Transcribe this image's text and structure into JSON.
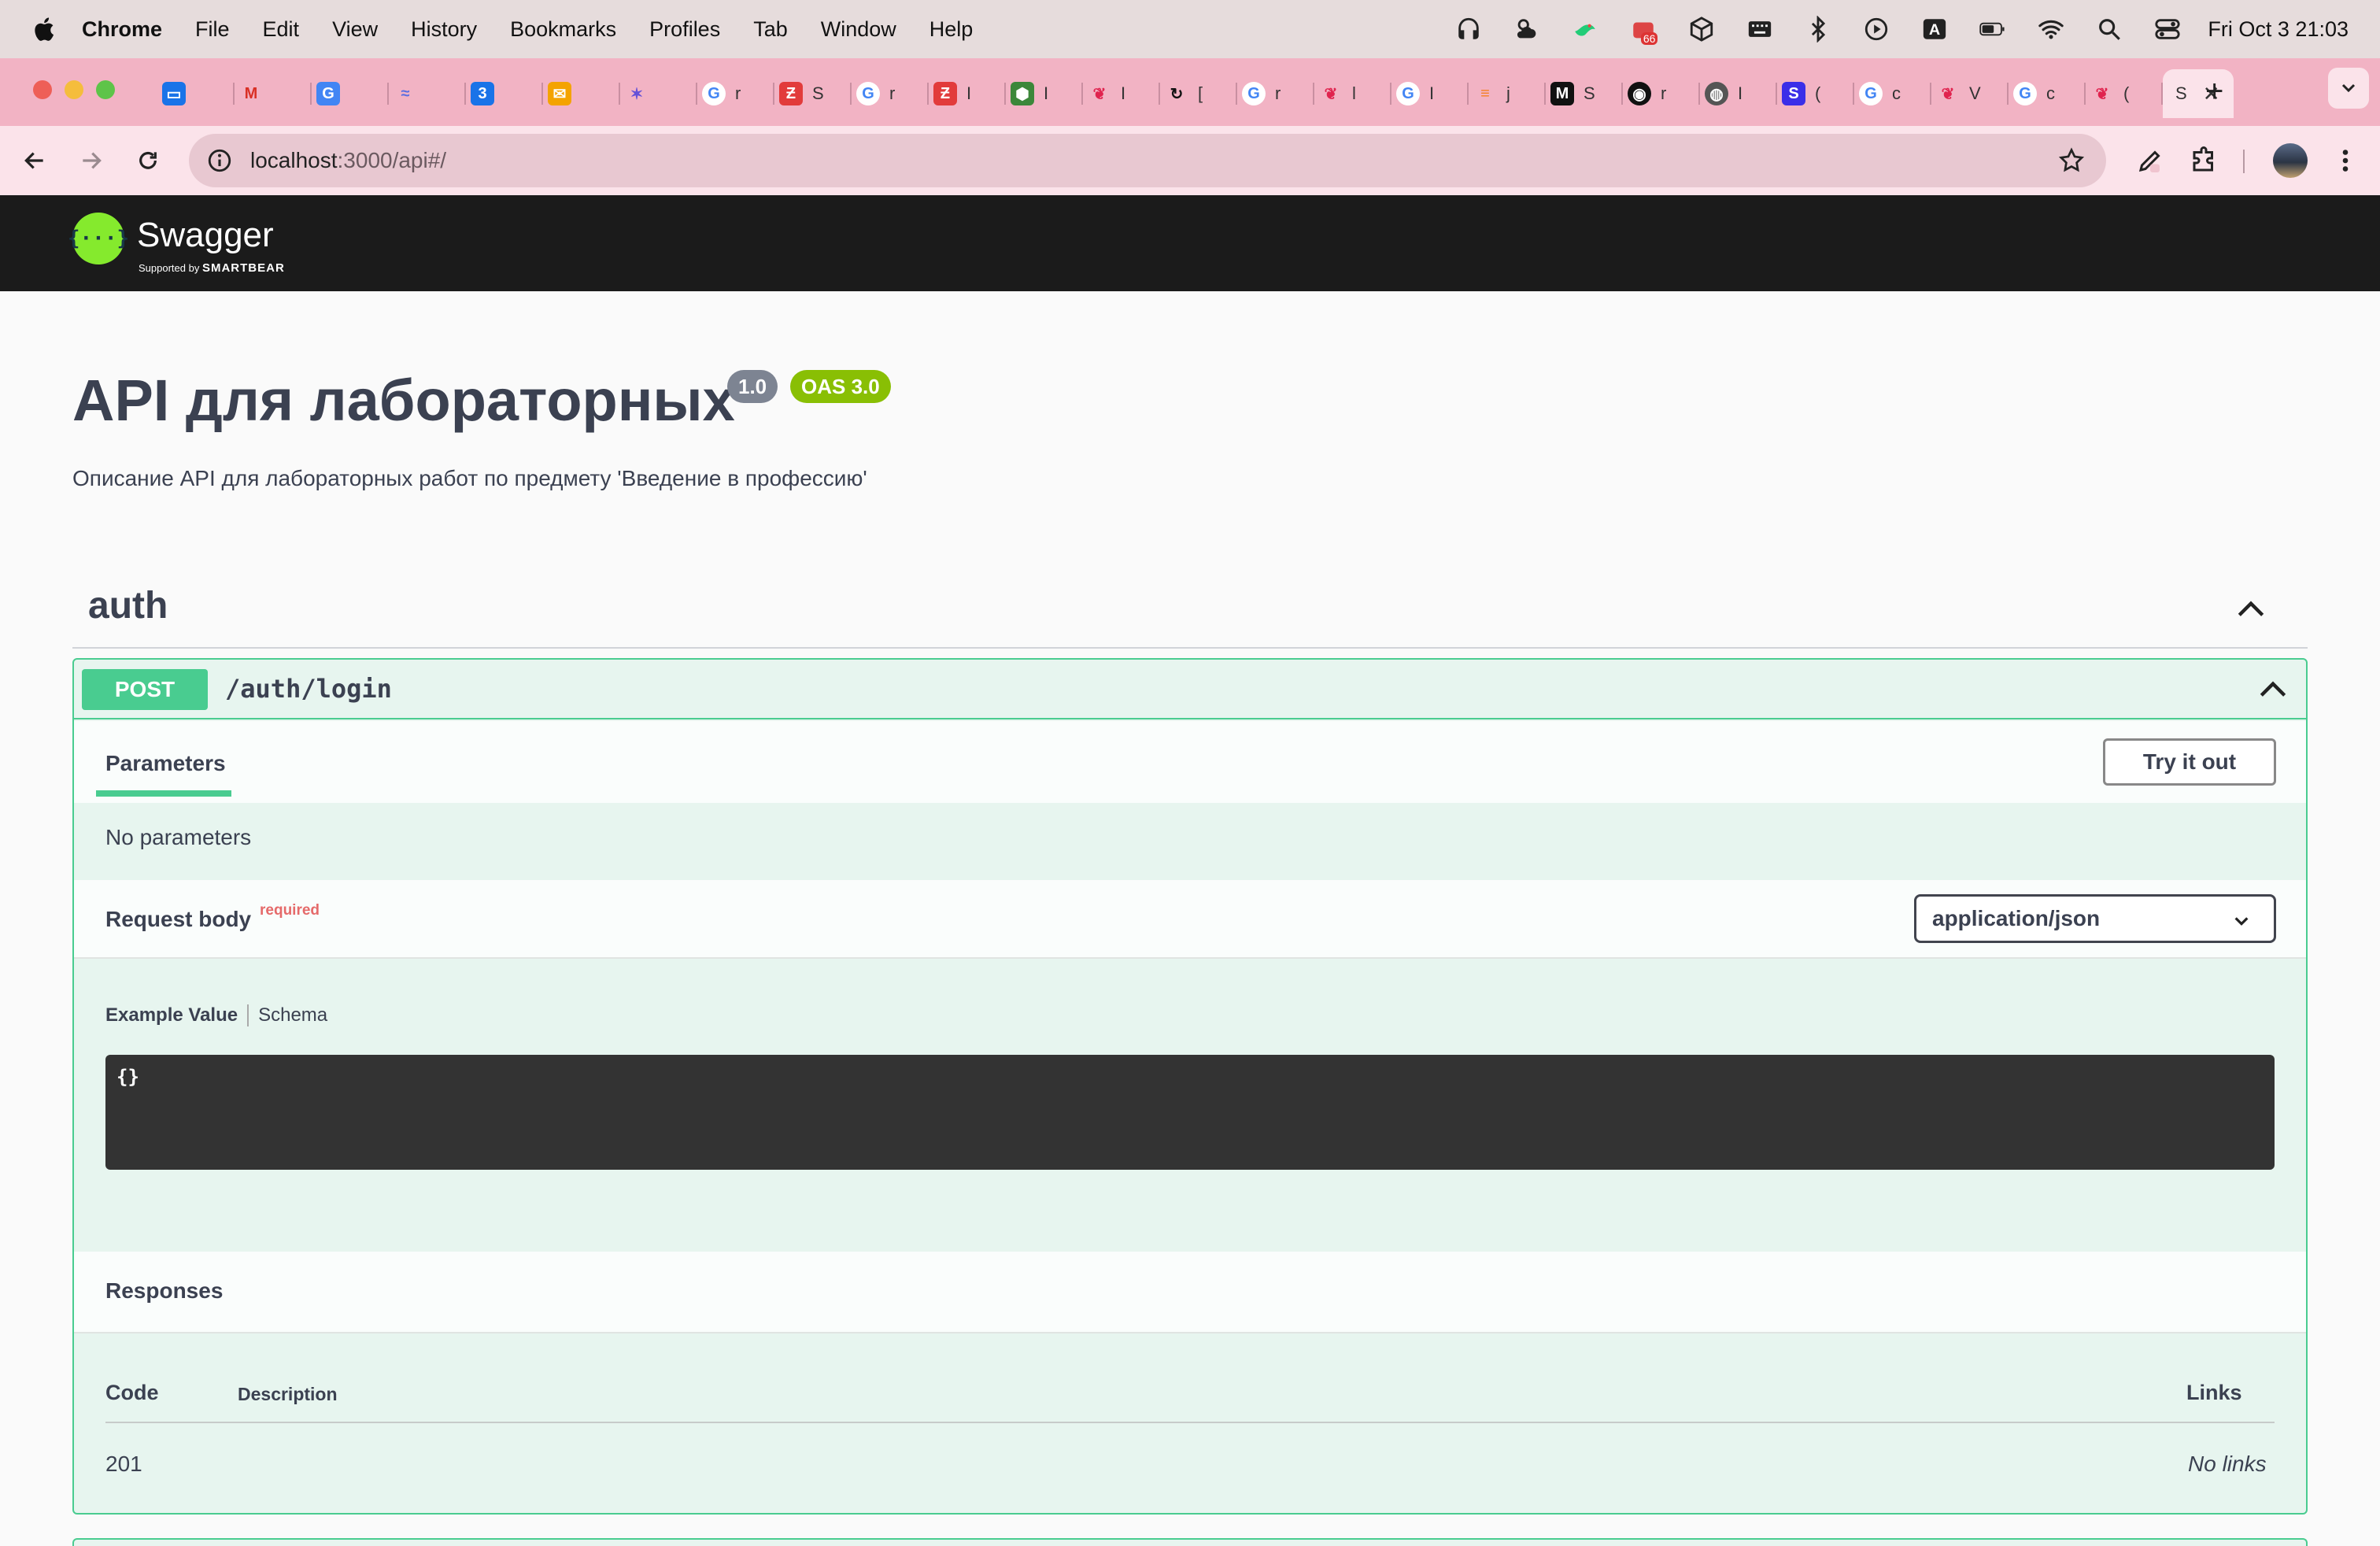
{
  "menubar": {
    "app": "Chrome",
    "items": [
      "File",
      "Edit",
      "View",
      "History",
      "Bookmarks",
      "Profiles",
      "Tab",
      "Window",
      "Help"
    ],
    "clock": "Fri Oct 3  21:03",
    "battery_badge": "66"
  },
  "tabs": {
    "active_label": "S",
    "items": [
      {
        "icon": "chat-icon",
        "label": ""
      },
      {
        "icon": "gmail-icon",
        "label": ""
      },
      {
        "icon": "translate-icon",
        "label": ""
      },
      {
        "icon": "bird-icon",
        "label": ""
      },
      {
        "icon": "calendar-icon",
        "label": ""
      },
      {
        "icon": "mail-icon",
        "label": ""
      },
      {
        "icon": "star-icon",
        "label": ""
      },
      {
        "icon": "google-icon",
        "label": "r"
      },
      {
        "icon": "habr-icon",
        "label": "S"
      },
      {
        "icon": "google-icon",
        "label": "r"
      },
      {
        "icon": "habr-icon",
        "label": "I"
      },
      {
        "icon": "node-icon",
        "label": "I"
      },
      {
        "icon": "nest-icon",
        "label": "I"
      },
      {
        "icon": "refresh-icon",
        "label": "["
      },
      {
        "icon": "google-icon",
        "label": "r"
      },
      {
        "icon": "nest-icon",
        "label": "l"
      },
      {
        "icon": "google-icon",
        "label": "I"
      },
      {
        "icon": "stackoverflow-icon",
        "label": "j"
      },
      {
        "icon": "medium-icon",
        "label": "S"
      },
      {
        "icon": "github-icon",
        "label": "r"
      },
      {
        "icon": "globe-icon",
        "label": "I"
      },
      {
        "icon": "s-icon",
        "label": "("
      },
      {
        "icon": "google-icon",
        "label": "c"
      },
      {
        "icon": "nest-icon",
        "label": "V"
      },
      {
        "icon": "google-icon",
        "label": "c"
      },
      {
        "icon": "nest-icon",
        "label": "("
      }
    ]
  },
  "toolbar": {
    "url_host": "localhost",
    "url_rest": ":3000/api#/"
  },
  "swagger": {
    "name": "Swagger",
    "supported_by": "Supported by",
    "brand": "SMARTBEAR"
  },
  "info": {
    "title": "API для лабораторных",
    "version": "1.0",
    "oas": "OAS 3.0",
    "description": "Описание API для лабораторных работ по предмету 'Введение в профессию'"
  },
  "tag": {
    "name": "auth"
  },
  "operation": {
    "method": "POST",
    "path": "/auth/login",
    "params_tab": "Parameters",
    "try_it_out": "Try it out",
    "no_params": "No parameters",
    "request_body": "Request body",
    "required": "required",
    "content_type": "application/json",
    "example_value": "Example Value",
    "schema": "Schema",
    "example_code": "{}",
    "responses_title": "Responses",
    "col_code": "Code",
    "col_description": "Description",
    "col_links": "Links",
    "responses": [
      {
        "code": "201",
        "description": "",
        "links": "No links"
      }
    ]
  },
  "colors": {
    "post_green": "#49cc90",
    "version_badge": "#7d8492",
    "oas_badge": "#89bf04",
    "swagger_bar": "#1b1b1b",
    "tabstrip": "#f2b3c4"
  }
}
